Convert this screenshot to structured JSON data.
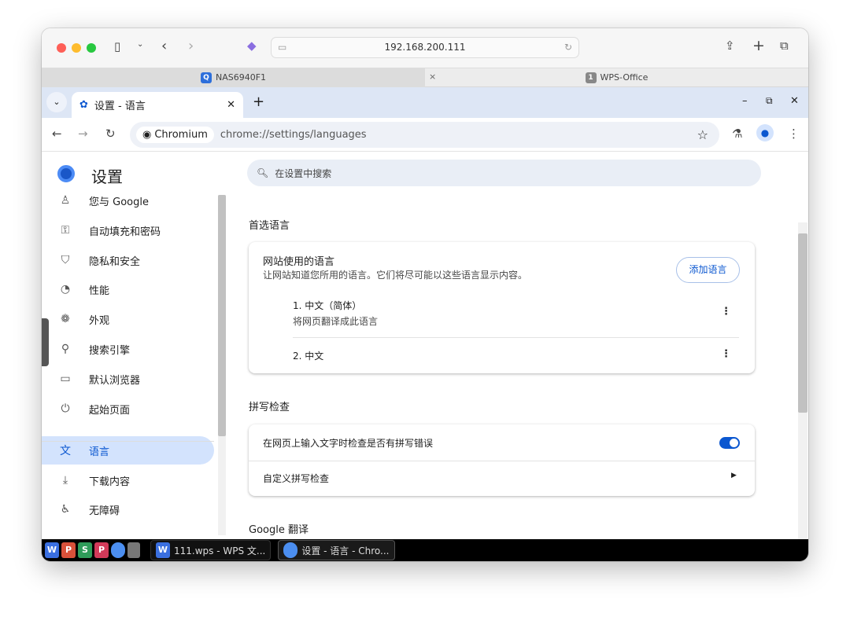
{
  "safari": {
    "url": "192.168.200.111",
    "tabs": [
      {
        "label": "NAS6940F1",
        "icon": "Q"
      },
      {
        "label": "WPS-Office",
        "icon": "1"
      }
    ]
  },
  "chrome": {
    "tab_title": "设置 - 语言",
    "chip": "Chromium",
    "url": "chrome://settings/languages"
  },
  "sidebar": {
    "title": "设置",
    "items": [
      {
        "label": "您与 Google",
        "icon": "person-icon"
      },
      {
        "label": "自动填充和密码",
        "icon": "key-icon"
      },
      {
        "label": "隐私和安全",
        "icon": "shield-icon"
      },
      {
        "label": "性能",
        "icon": "gauge-icon"
      },
      {
        "label": "外观",
        "icon": "palette-icon"
      },
      {
        "label": "搜索引擎",
        "icon": "search-icon"
      },
      {
        "label": "默认浏览器",
        "icon": "browser-icon"
      },
      {
        "label": "起始页面",
        "icon": "power-icon"
      },
      {
        "label": "语言",
        "icon": "translate-icon",
        "selected": true
      },
      {
        "label": "下载内容",
        "icon": "download-icon"
      },
      {
        "label": "无障碍",
        "icon": "accessibility-icon"
      }
    ]
  },
  "main": {
    "search_placeholder": "在设置中搜索",
    "preferred": {
      "heading": "首选语言",
      "card_title": "网站使用的语言",
      "card_desc": "让网站知道您所用的语言。它们将尽可能以这些语言显示内容。",
      "add_button": "添加语言",
      "languages": [
        {
          "label": "1. 中文（简体）",
          "sub": "将网页翻译成此语言"
        },
        {
          "label": "2. 中文",
          "sub": ""
        }
      ]
    },
    "spell": {
      "heading": "拼写检查",
      "toggle_label": "在网页上输入文字时检查是否有拼写错误",
      "toggle_on": true,
      "custom": "自定义拼写检查"
    },
    "translate": {
      "heading": "Google 翻译"
    }
  },
  "taskbar": {
    "windows": [
      "111.wps - WPS 文...",
      "设置 - 语言 - Chro..."
    ]
  },
  "colors": {
    "accent": "#0b57d0",
    "selected_bg": "#d3e3fd",
    "tabstrip": "#dde6f5"
  }
}
